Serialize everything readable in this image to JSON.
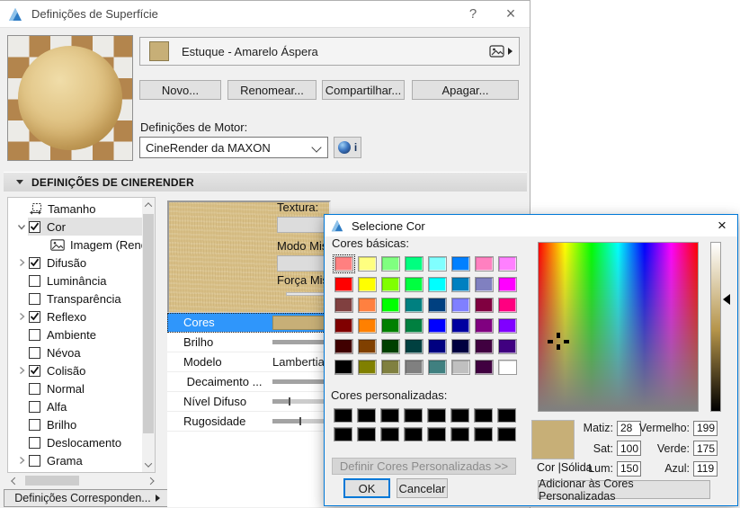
{
  "window": {
    "title": "Definições de Superfície",
    "help": "?",
    "close": "×",
    "material": {
      "name": "Estuque - Amarelo Áspera",
      "color": "#C7AF77"
    },
    "actions": {
      "new": "Novo...",
      "rename": "Renomear...",
      "share": "Compartilhar...",
      "delete": "Apagar..."
    },
    "engine": {
      "label": "Definições de Motor:",
      "selected": "CineRender da MAXON",
      "info": "i"
    },
    "section": {
      "title": "DEFINIÇÕES DE CINERENDER"
    },
    "tree": {
      "items": [
        {
          "label": "Tamanho",
          "icon": "size",
          "checkbox": false,
          "checked": false,
          "chevron": null,
          "indent": 0,
          "highlight": false
        },
        {
          "label": "Cor",
          "icon": null,
          "checkbox": true,
          "checked": true,
          "chevron": "down",
          "indent": 0,
          "highlight": true
        },
        {
          "label": "Imagem (Renderiza",
          "icon": "image",
          "checkbox": false,
          "checked": false,
          "chevron": null,
          "indent": 1,
          "highlight": false
        },
        {
          "label": "Difusão",
          "icon": null,
          "checkbox": true,
          "checked": true,
          "chevron": "right",
          "indent": 0,
          "highlight": false
        },
        {
          "label": "Luminância",
          "icon": null,
          "checkbox": true,
          "checked": false,
          "chevron": null,
          "indent": 0,
          "highlight": false
        },
        {
          "label": "Transparência",
          "icon": null,
          "checkbox": true,
          "checked": false,
          "chevron": null,
          "indent": 0,
          "highlight": false
        },
        {
          "label": "Reflexo",
          "icon": null,
          "checkbox": true,
          "checked": true,
          "chevron": "right",
          "indent": 0,
          "highlight": false
        },
        {
          "label": "Ambiente",
          "icon": null,
          "checkbox": true,
          "checked": false,
          "chevron": null,
          "indent": 0,
          "highlight": false
        },
        {
          "label": "Névoa",
          "icon": null,
          "checkbox": true,
          "checked": false,
          "chevron": null,
          "indent": 0,
          "highlight": false
        },
        {
          "label": "Colisão",
          "icon": null,
          "checkbox": true,
          "checked": true,
          "chevron": "right",
          "indent": 0,
          "highlight": false
        },
        {
          "label": "Normal",
          "icon": null,
          "checkbox": true,
          "checked": false,
          "chevron": null,
          "indent": 0,
          "highlight": false
        },
        {
          "label": "Alfa",
          "icon": null,
          "checkbox": true,
          "checked": false,
          "chevron": null,
          "indent": 0,
          "highlight": false
        },
        {
          "label": "Brilho",
          "icon": null,
          "checkbox": true,
          "checked": false,
          "chevron": null,
          "indent": 0,
          "highlight": false
        },
        {
          "label": "Deslocamento",
          "icon": null,
          "checkbox": true,
          "checked": false,
          "chevron": null,
          "indent": 0,
          "highlight": false
        },
        {
          "label": "Grama",
          "icon": null,
          "checkbox": true,
          "checked": false,
          "chevron": "right",
          "indent": 0,
          "highlight": false
        }
      ]
    },
    "texture_panel": {
      "texture": "Textura:",
      "blend_mode": "Modo Mis",
      "blend_strength": "Força Mist"
    },
    "properties": {
      "rows": [
        {
          "label": "Cores",
          "type": "color",
          "selected": true,
          "color": "#C7AF77"
        },
        {
          "label": "Brilho",
          "type": "slider",
          "fill_pct": 100,
          "thumb_pct": null
        },
        {
          "label": "Modelo",
          "type": "text",
          "value": "Lambertian"
        },
        {
          "label": " Decaimento ...",
          "type": "slider",
          "fill_pct": 100,
          "thumb_pct": null
        },
        {
          "label": "Nível Difuso",
          "type": "slider",
          "fill_pct": 7,
          "thumb_pct": 7
        },
        {
          "label": "Rugosidade",
          "type": "slider",
          "fill_pct": 12,
          "thumb_pct": 12
        }
      ]
    },
    "footer_button": "Definições Corresponden..."
  },
  "color_dialog": {
    "title": "Selecione Cor",
    "close": "×",
    "basic_label": "Cores básicas:",
    "basic_colors": [
      "#FF8080",
      "#FFFF80",
      "#80FF80",
      "#00FF80",
      "#80FFFF",
      "#0080FF",
      "#FF80C0",
      "#FF80FF",
      "#FF0000",
      "#FFFF00",
      "#80FF00",
      "#00FF40",
      "#00FFFF",
      "#0080C0",
      "#8080C0",
      "#FF00FF",
      "#804040",
      "#FF8040",
      "#00FF00",
      "#008080",
      "#004080",
      "#8080FF",
      "#800040",
      "#FF0080",
      "#800000",
      "#FF8000",
      "#008000",
      "#008040",
      "#0000FF",
      "#0000A0",
      "#800080",
      "#8000FF",
      "#400000",
      "#804000",
      "#004000",
      "#004040",
      "#000080",
      "#000040",
      "#400040",
      "#400080",
      "#000000",
      "#808000",
      "#808040",
      "#808080",
      "#408080",
      "#C0C0C0",
      "#400040",
      "#FFFFFF"
    ],
    "selected_basic_index": 0,
    "custom_label": "Cores personalizadas:",
    "custom_colors": [
      "#000000",
      "#000000",
      "#000000",
      "#000000",
      "#000000",
      "#000000",
      "#000000",
      "#000000",
      "#000000",
      "#000000",
      "#000000",
      "#000000",
      "#000000",
      "#000000",
      "#000000",
      "#000000"
    ],
    "define_custom": "Definir Cores Personalizadas >>",
    "ok": "OK",
    "cancel": "Cancelar",
    "add_custom": "Adicionar às Cores Personalizadas",
    "preview": {
      "color": "#C7AF77",
      "label": "Cor |Sólida"
    },
    "hsl_fields": [
      {
        "label": "Matiz:",
        "value": "28"
      },
      {
        "label": "Sat:",
        "value": "100"
      },
      {
        "label": "Lum:",
        "value": "150"
      }
    ],
    "rgb_fields": [
      {
        "label": "Vermelho:",
        "value": "199"
      },
      {
        "label": "Verde:",
        "value": "175"
      },
      {
        "label": "Azul:",
        "value": "119"
      }
    ]
  }
}
